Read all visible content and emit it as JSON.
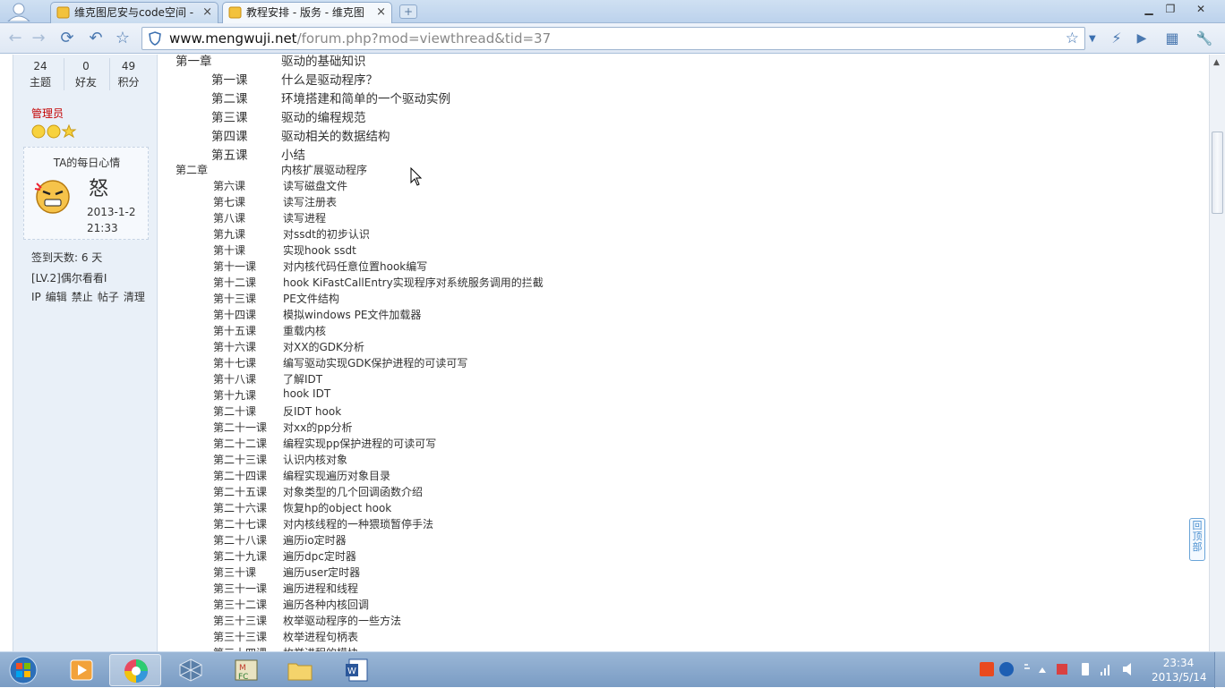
{
  "browser": {
    "tabs": [
      {
        "title": "维克图尼安与code空间 -",
        "close": "×",
        "active": false
      },
      {
        "title": "教程安排 - 版务 - 维克图",
        "close": "×",
        "active": true
      }
    ],
    "new_tab": "+",
    "url_domain": "www.mengwuji.net",
    "url_path": "/forum.php?mod=viewthread&tid=37"
  },
  "sidebar": {
    "stats": [
      {
        "value": "24",
        "label": "主题"
      },
      {
        "value": "0",
        "label": "好友"
      },
      {
        "value": "49",
        "label": "积分"
      }
    ],
    "role": "管理员",
    "mood": {
      "title": "TA的每日心情",
      "mood_char": "怒",
      "date": "2013-1-2",
      "time": "21:33"
    },
    "signin": "签到天数: 6 天",
    "level": "[LV.2]偶尔看看I",
    "actions": [
      "IP",
      "编辑",
      "禁止",
      "帖子",
      "清理"
    ]
  },
  "content": {
    "chapter1": {
      "label": "第一章",
      "title": "驱动的基础知识"
    },
    "chapter1_lessons": [
      {
        "label": "第一课",
        "title": "什么是驱动程序？"
      },
      {
        "label": "第二课",
        "title": "环境搭建和简单的一个驱动实例"
      },
      {
        "label": "第三课",
        "title": "驱动的编程规范"
      },
      {
        "label": "第四课",
        "title": "驱动相关的数据结构"
      },
      {
        "label": "第五课",
        "title": "小结"
      }
    ],
    "chapter2": {
      "label": "第二章",
      "title": "内核扩展驱动程序"
    },
    "chapter2_lessons": [
      {
        "label": "第六课",
        "title": "读写磁盘文件"
      },
      {
        "label": "第七课",
        "title": "读写注册表"
      },
      {
        "label": "第八课",
        "title": "读写进程"
      },
      {
        "label": "第九课",
        "title": "对ssdt的初步认识"
      },
      {
        "label": "第十课",
        "title": "实现hook ssdt"
      },
      {
        "label": "第十一课",
        "title": "对内核代码任意位置hook编写"
      },
      {
        "label": "第十二课",
        "title": "hook KiFastCallEntry实现程序对系统服务调用的拦截"
      },
      {
        "label": "第十三课",
        "title": "PE文件结构"
      },
      {
        "label": "第十四课",
        "title": "模拟windows PE文件加载器"
      },
      {
        "label": "第十五课",
        "title": "重载内核"
      },
      {
        "label": "第十六课",
        "title": "对XX的GDK分析"
      },
      {
        "label": "第十七课",
        "title": "编写驱动实现GDK保护进程的可读可写"
      },
      {
        "label": "第十八课",
        "title": "了解IDT"
      },
      {
        "label": "第十九课",
        "title": "hook IDT"
      },
      {
        "label": "第二十课",
        "title": "反IDT hook"
      },
      {
        "label": "第二十一课",
        "title": "对xx的pp分析"
      },
      {
        "label": "第二十二课",
        "title": "编程实现pp保护进程的可读可写"
      },
      {
        "label": "第二十三课",
        "title": "认识内核对象"
      },
      {
        "label": "第二十四课",
        "title": "编程实现遍历对象目录"
      },
      {
        "label": "第二十五课",
        "title": "对象类型的几个回调函数介绍"
      },
      {
        "label": "第二十六课",
        "title": "恢复hp的object hook"
      },
      {
        "label": "第二十七课",
        "title": "对内核线程的一种猥琐暂停手法"
      },
      {
        "label": "第二十八课",
        "title": "遍历io定时器"
      },
      {
        "label": "第二十九课",
        "title": "遍历dpc定时器"
      },
      {
        "label": "第三十课",
        "title": "遍历user定时器"
      },
      {
        "label": "第三十一课",
        "title": "遍历进程和线程"
      },
      {
        "label": "第三十二课",
        "title": "遍历各种内核回调"
      },
      {
        "label": "第三十三课",
        "title": "枚举驱动程序的一些方法"
      },
      {
        "label": "第三十三课",
        "title": "枚举进程句柄表"
      },
      {
        "label": "第三十四课",
        "title": "枚举进程的模块"
      }
    ],
    "back_to_top": "回顶部"
  },
  "taskbar": {
    "time": "23:34",
    "date": "2013/5/14"
  },
  "colors": {
    "role": "#c40000",
    "taskbar": "#7a9cc4",
    "sidebar_bg": "#e9f0f8"
  }
}
